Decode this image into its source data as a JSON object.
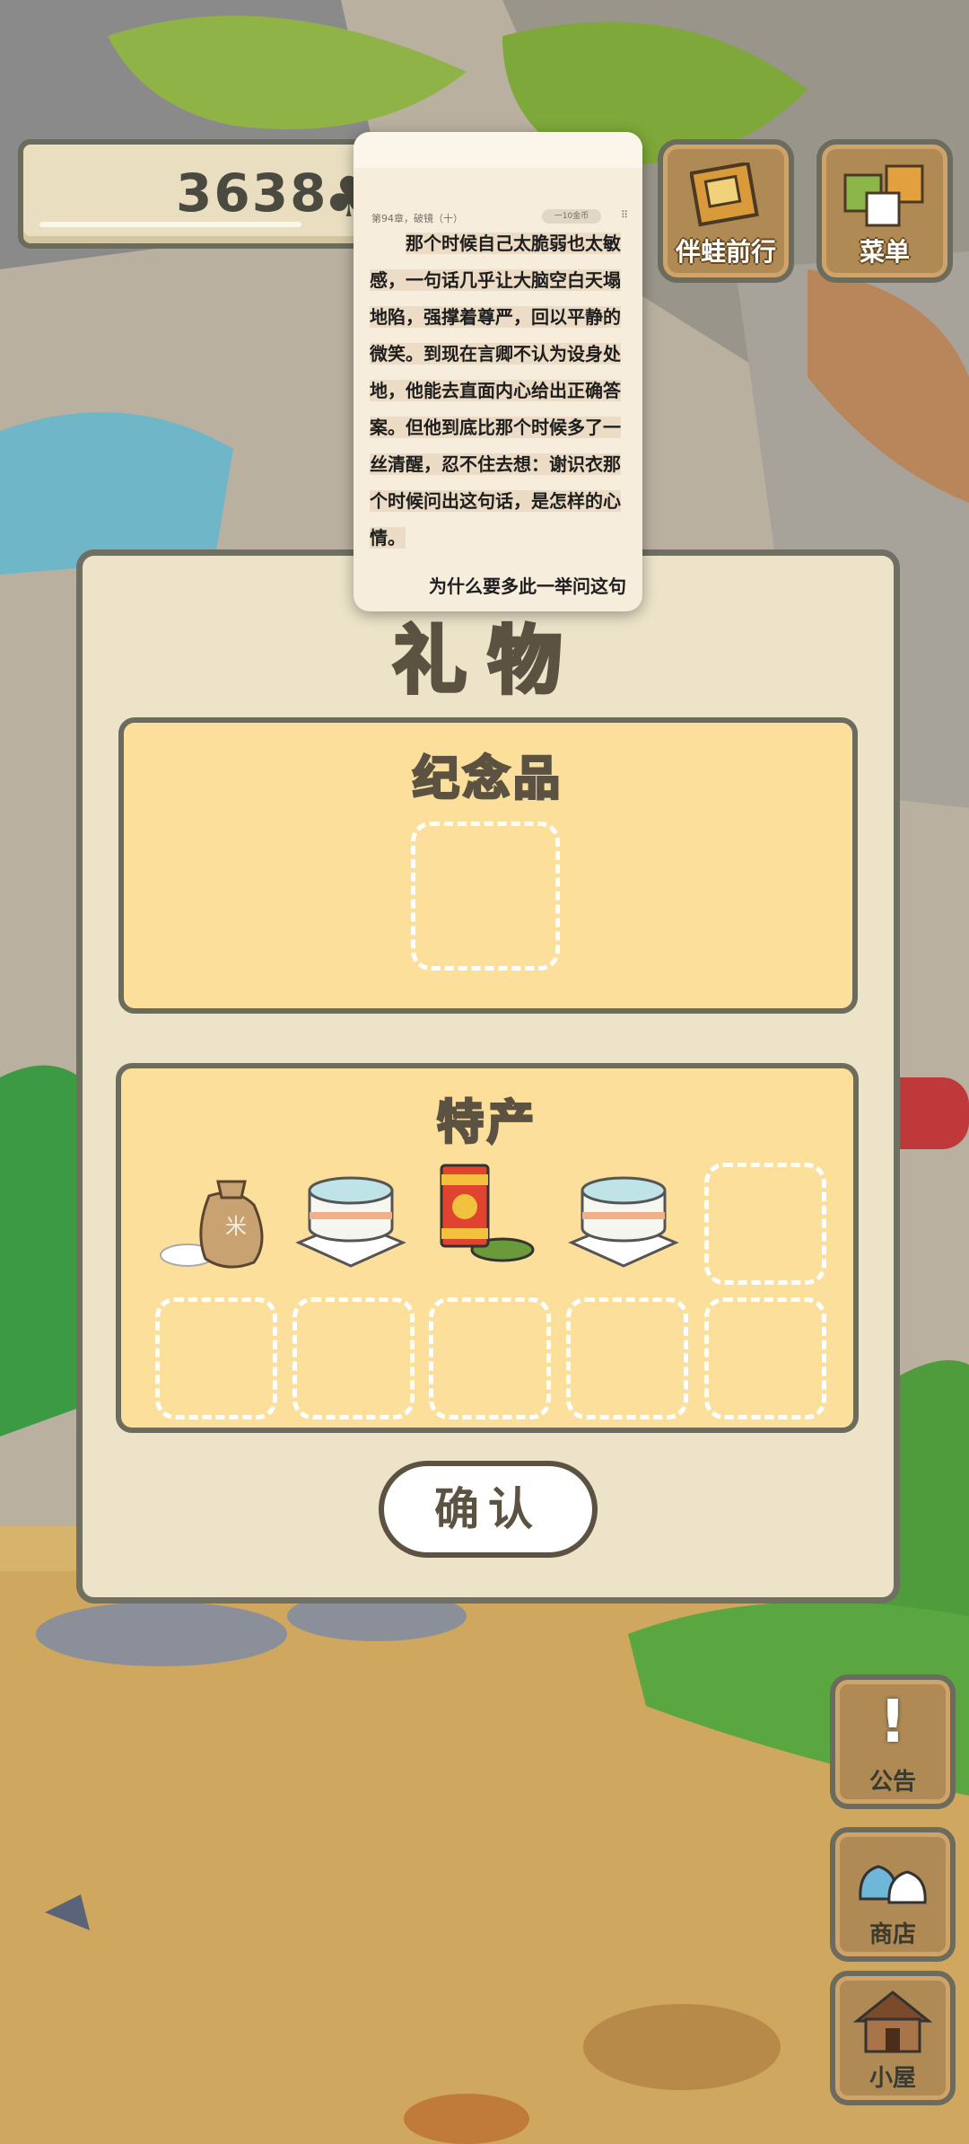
{
  "counter": {
    "value": "3638",
    "icon": "clover-icon"
  },
  "top_buttons": [
    {
      "label": "伴蛙前行",
      "icon": "photo-album-icon"
    },
    {
      "label": "菜单",
      "icon": "menu-cards-icon"
    }
  ],
  "side_buttons": [
    {
      "label": "公告",
      "icon": "exclamation-icon"
    },
    {
      "label": "商店",
      "icon": "shop-bags-icon"
    },
    {
      "label": "小屋",
      "icon": "house-icon"
    }
  ],
  "dialog": {
    "title": "礼物",
    "souvenir_label": "纪念品",
    "specialty_label": "特产",
    "specialty_items": [
      "rice-bag-icon",
      "cake-icon",
      "tea-can-icon",
      "cake-icon"
    ],
    "confirm_label": "确认"
  },
  "popup": {
    "chapter": "第94章，破镜（十）",
    "coin": "一10金币",
    "more": "⠿",
    "body": "那个时候自己太脆弱也太敏感，一句话几乎让大脑空白天塌地陷，强撑着尊严，回以平静的微笑。到现在言卿不认为设身处地，他能去直面内心给出正确答案。但他到底比那个时候多了一丝清醒，忍不住去想：谢识衣那个时候问出这句话，是怎样的心情。",
    "footer": "为什么要多此一举问这句"
  },
  "colors": {
    "panel": "#fddf9c",
    "dialog": "#ece3c8",
    "outline": "#6b6b5e",
    "wood": "#b08a55"
  }
}
